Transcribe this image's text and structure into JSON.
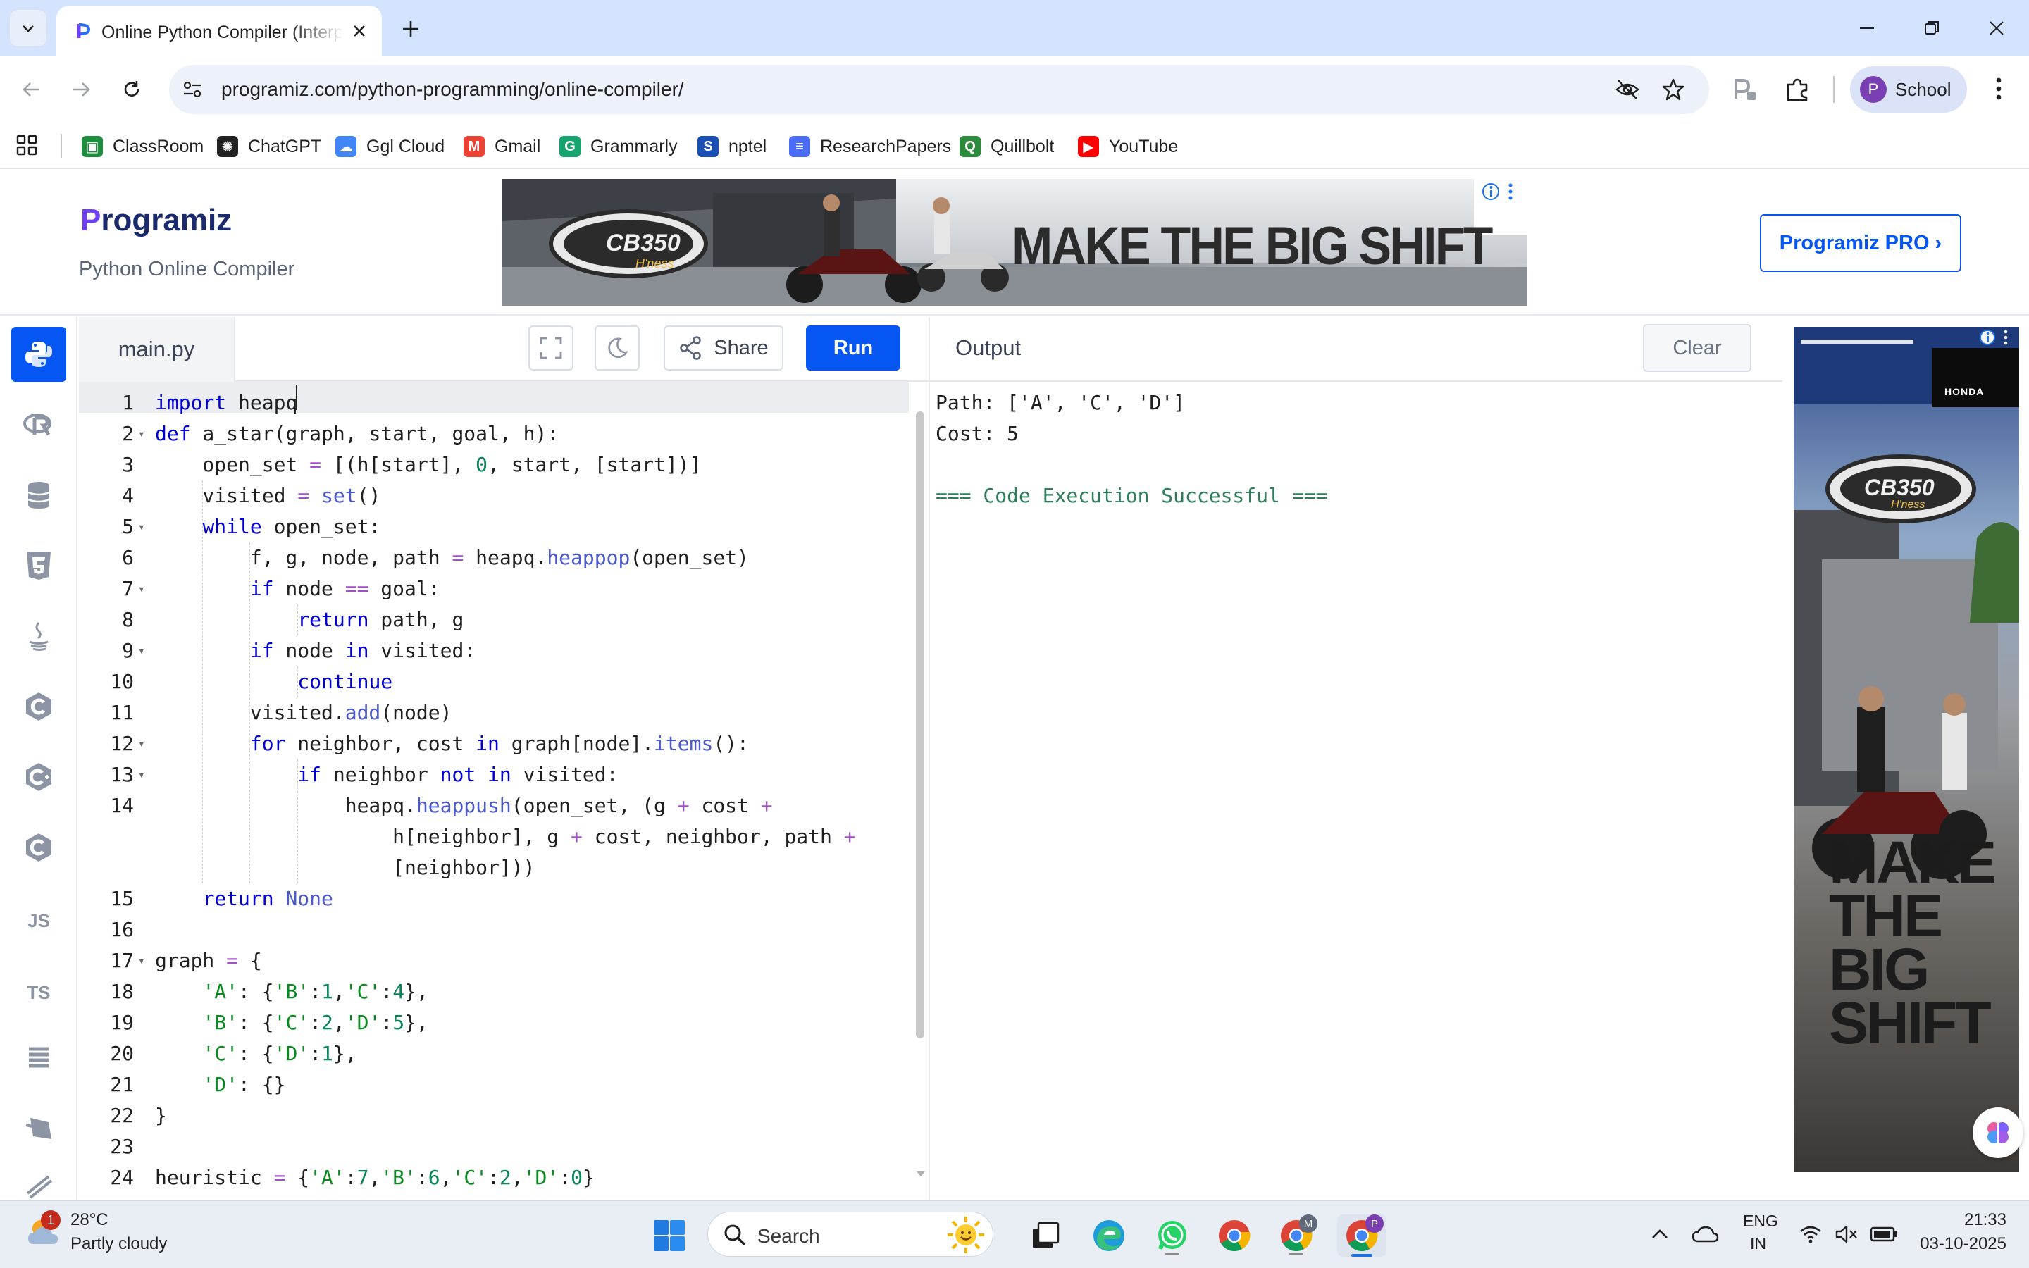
{
  "browser": {
    "tab_title": "Online Python Compiler (Interpreter)",
    "url": "programiz.com/python-programming/online-compiler/",
    "profile_initial": "P",
    "profile_label": "School"
  },
  "bookmarks": [
    {
      "label": "ClassRoom",
      "icon": "google-classroom-icon",
      "color": "#1e8e3e"
    },
    {
      "label": "ChatGPT",
      "icon": "chatgpt-icon",
      "color": "#222222"
    },
    {
      "label": "Ggl Cloud",
      "icon": "google-cloud-icon",
      "color": "#4285f4"
    },
    {
      "label": "Gmail",
      "icon": "gmail-icon",
      "color": "#ea4335"
    },
    {
      "label": "Grammarly",
      "icon": "grammarly-icon",
      "color": "#15a36e"
    },
    {
      "label": "nptel",
      "icon": "nptel-icon",
      "color": "#1a4fb3"
    },
    {
      "label": "ResearchPapers",
      "icon": "docs-icon",
      "color": "#4a6cf7"
    },
    {
      "label": "Quillbolt",
      "icon": "quillbot-icon",
      "color": "#2e8b3d"
    },
    {
      "label": "YouTube",
      "icon": "youtube-icon",
      "color": "#ff0000"
    }
  ],
  "header": {
    "logo_text": "rogramiz",
    "logo_p": "P",
    "subtitle": "Python Online Compiler",
    "pro_button": "Programiz PRO ›",
    "banner_ad": {
      "badge": "CB350",
      "sub": "H'ness",
      "headline": "MAKE THE BIG SHIFT"
    }
  },
  "rail": [
    "python-icon",
    "r-icon",
    "sql-icon",
    "html5-icon",
    "java-icon",
    "c-icon",
    "cpp-icon",
    "csharp-icon",
    "js-icon",
    "ts-icon",
    "go-icon",
    "php-icon",
    "swift-icon"
  ],
  "rail_labels": {
    "js": "JS",
    "ts": "TS"
  },
  "editor": {
    "filename": "main.py",
    "share_label": "Share",
    "run_label": "Run",
    "line_numbers": [
      "1",
      "2",
      "3",
      "4",
      "5",
      "6",
      "7",
      "8",
      "9",
      "10",
      "11",
      "12",
      "13",
      "14",
      "",
      "",
      "15",
      "16",
      "17",
      "18",
      "19",
      "20",
      "21",
      "22",
      "23",
      "24"
    ]
  },
  "code": [
    "import heapq",
    "def a_star(graph, start, goal, h):",
    "    open_set = [(h[start], 0, start, [start])]",
    "    visited = set()",
    "    while open_set:",
    "        f, g, node, path = heapq.heappop(open_set)",
    "        if node == goal:",
    "            return path, g",
    "        if node in visited:",
    "            continue",
    "        visited.add(node)",
    "        for neighbor, cost in graph[node].items():",
    "            if neighbor not in visited:",
    "                heapq.heappush(open_set, (g + cost +",
    "                    h[neighbor], g + cost, neighbor, path +",
    "                    [neighbor]))",
    "    return None",
    "",
    "graph = {",
    "    'A': {'B':1,'C':4},",
    "    'B': {'C':2,'D':5},",
    "    'C': {'D':1},",
    "    'D': {}",
    "}",
    "",
    "heuristic = {'A':7,'B':6,'C':2,'D':0}"
  ],
  "output": {
    "title": "Output",
    "clear_label": "Clear",
    "lines": [
      "Path: ['A', 'C', 'D']",
      "Cost: 5",
      "",
      "=== Code Execution Successful ==="
    ]
  },
  "side_ad": {
    "brand": "HONDA",
    "badge": "CB350",
    "sub": "H'ness",
    "headline_lines": [
      "MAKE",
      "THE",
      "BIG",
      "SHIFT"
    ]
  },
  "taskbar": {
    "weather_temp": "28°C",
    "weather_desc": "Partly cloudy",
    "weather_badge": "1",
    "search_label": "Search",
    "lang_top": "ENG",
    "lang_bottom": "IN",
    "time": "21:33",
    "date": "03-10-2025",
    "chrome_badge_1": "M",
    "chrome_badge_2": "P"
  },
  "colors": {
    "accent": "#0556f3",
    "tabbar": "#d3e3fd",
    "success": "#2e7d5b"
  }
}
